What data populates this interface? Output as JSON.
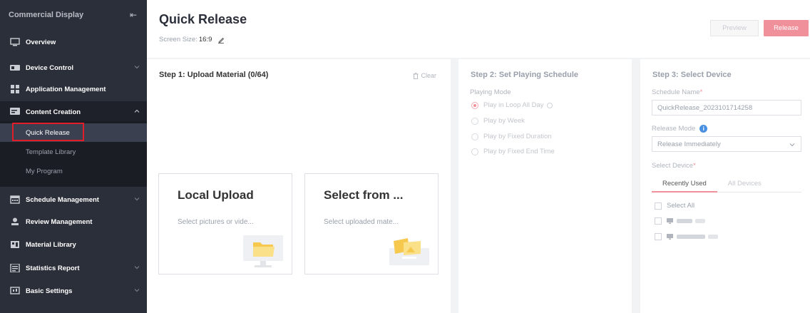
{
  "sidebar": {
    "title": "Commercial Display",
    "overview": "Overview",
    "items": [
      {
        "label": "Device Control",
        "icon": "device-control-icon"
      },
      {
        "label": "Application Management",
        "icon": "application-icon"
      },
      {
        "label": "Content Creation",
        "icon": "content-creation-icon"
      },
      {
        "label": "Schedule Management",
        "icon": "schedule-icon"
      },
      {
        "label": "Review Management",
        "icon": "review-icon"
      },
      {
        "label": "Material Library",
        "icon": "material-library-icon"
      },
      {
        "label": "Statistics Report",
        "icon": "statistics-icon"
      },
      {
        "label": "Basic Settings",
        "icon": "settings-icon"
      }
    ],
    "sub_items": [
      "Quick Release",
      "Template Library",
      "My Program"
    ]
  },
  "header": {
    "title": "Quick Release",
    "screen_size_label": "Screen Size:",
    "screen_size_value": "16:9",
    "preview": "Preview",
    "release": "Release"
  },
  "step1": {
    "title": "Step 1: Upload Material (0/64)",
    "clear": "Clear",
    "local_upload_title": "Local Upload",
    "local_upload_desc": "Select pictures or vide...",
    "select_from_title": "Select from ...",
    "select_from_desc": "Select uploaded mate..."
  },
  "step2": {
    "title": "Step 2: Set Playing Schedule",
    "mode_label": "Playing Mode",
    "options": [
      "Play in Loop All Day",
      "Play by Week",
      "Play by Fixed Duration",
      "Play by Fixed End Time"
    ],
    "selected": "Play in Loop All Day"
  },
  "step3": {
    "title": "Step 3: Select Device",
    "schedule_name_label": "Schedule Name",
    "schedule_name_value": "Quick Release_20231017142 58",
    "release_mode_label": "Release Mode",
    "release_mode_value": "Release Immediately",
    "select_device_label": "Select Device",
    "tabs": [
      "Recently Used",
      "All Devices"
    ],
    "select_all": "Select All"
  },
  "colors": {
    "sidebar_bg": "#2b2f3a",
    "accent": "#f0909a",
    "highlight": "#e11d2a"
  }
}
